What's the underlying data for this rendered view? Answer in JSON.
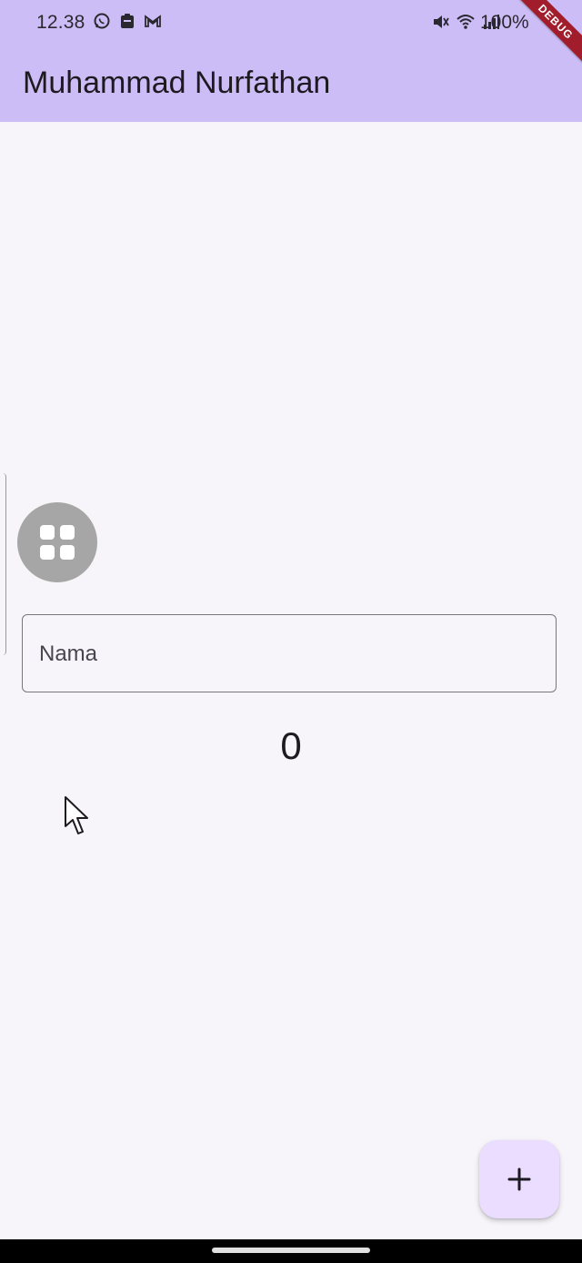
{
  "status_bar": {
    "time": "12.38",
    "battery": "100%",
    "left_icons": [
      "whatsapp-icon",
      "clipboard-icon",
      "gmail-icon"
    ],
    "right_icons": [
      "mute-icon",
      "wifi-icon",
      "signal-icon"
    ]
  },
  "app_bar": {
    "title": "Muhammad Nurfathan",
    "background": "#cdbdf7"
  },
  "debug_banner": {
    "label": "DEBUG"
  },
  "form": {
    "avatar_icon": "grid-view-icon",
    "name_placeholder": "Nama",
    "name_value": ""
  },
  "counter": {
    "value": "0"
  },
  "fab": {
    "icon": "plus-icon",
    "label": "+"
  },
  "colors": {
    "primary_container": "#eaddff",
    "surface": "#f7f5f9",
    "avatar_gray": "#a6a6a6"
  }
}
